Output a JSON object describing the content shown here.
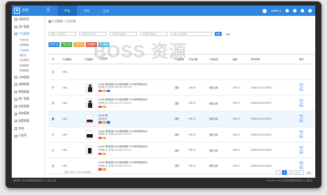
{
  "app": {
    "logo_text": "东莞",
    "menu_glyph": "☰"
  },
  "topnav": [
    {
      "label": "平台",
      "active": true
    },
    {
      "label": "手机",
      "active": false
    },
    {
      "label": "日志",
      "active": false
    }
  ],
  "user": {
    "name": "Admin ▾"
  },
  "sidebar": {
    "items": [
      {
        "label": "系统首页",
        "open": false
      },
      {
        "label": "用户管理",
        "open": false
      },
      {
        "label": "产品管理",
        "open": true
      },
      {
        "label": "订单管理",
        "open": false
      },
      {
        "label": "商铺管理",
        "open": false
      },
      {
        "label": "数据管理",
        "open": false
      },
      {
        "label": "推广管理",
        "open": false
      },
      {
        "label": "信息管理",
        "open": false
      },
      {
        "label": "系统管理",
        "open": false
      },
      {
        "label": "配置管理",
        "open": false
      },
      {
        "label": "其他",
        "open": false
      },
      {
        "label": "小程序",
        "open": false
      }
    ],
    "subitems": [
      {
        "label": "产品分类",
        "active": false
      },
      {
        "label": "品牌管理",
        "active": false
      },
      {
        "label": "产品列表",
        "active": true
      },
      {
        "label": "回收站",
        "active": false
      },
      {
        "label": "评论管理",
        "active": false
      },
      {
        "label": "咨询管理",
        "active": false
      },
      {
        "label": "规格管理",
        "active": false
      }
    ]
  },
  "breadcrumb": "产品管理 > 产品列表",
  "filters": {
    "placeholders": [
      "请输入产品名称",
      "请选择产品分类",
      "请选择产品品牌",
      "请选择产品状态"
    ],
    "wide_placeholder": "请输入产品编号",
    "search_label": "搜索",
    "reset_label": "重置"
  },
  "actions": [
    {
      "label": "添加产品",
      "color": "#2f85e0"
    },
    {
      "label": "产品上架",
      "color": "#44b549"
    },
    {
      "label": "产品下架",
      "color": "#f0ad4e"
    },
    {
      "label": "批量删除",
      "color": "#e85a4f"
    },
    {
      "label": "导出数据",
      "color": "#5bc0de"
    }
  ],
  "table": {
    "headers": [
      "产品编号",
      "产品图片",
      "产品名称",
      "产品品牌",
      "产品价格",
      "产品状态",
      "销量",
      "发布时间",
      "操作"
    ],
    "rows": [
      {
        "no": "1481",
        "name": "",
        "name2": "",
        "brand": "",
        "price": "",
        "status": "",
        "sale": "",
        "date": "",
        "tags": [],
        "selected": false,
        "image": "none"
      },
      {
        "no": "1481",
        "name": "schbie 萌妹款风 Shiel原装春季 2019秋季新款运动",
        "name2": "休闲鞋 女 男 鞋 OAR180 CM4746",
        "brand": "顶峰",
        "price": "199.00",
        "status": "销售出库",
        "sale": "199.00",
        "date": "2018/1/1/18 14:59:47",
        "tags": [
          "#e85a4f",
          "#f0ad4e",
          "#2f85e0"
        ],
        "selected": false,
        "image": "figure"
      },
      {
        "no": "1481",
        "name": "schbie 萌妹款风 Shiel原装春季 2019秋季新款运动",
        "name2": "休闲鞋 女 男 鞋 OAR180 CM4746",
        "brand": "顶峰",
        "price": "199.00",
        "status": "销售出库",
        "sale": "199.00",
        "date": "2018/1/1/18 14:59:47",
        "tags": [
          "#e85a4f",
          "#f0ad4e"
        ],
        "selected": false,
        "image": "figure"
      },
      {
        "no": "1481",
        "name": "schbie 萌",
        "name2": "萌妹款风",
        "brand": "顶峰",
        "price": "199.00",
        "status": "销售出库",
        "sale": "199.00",
        "date": "2018/1/1/18 14:59:47",
        "tags": [
          "#e85a4f",
          "#f0ad4e",
          "#2f85e0"
        ],
        "selected": true,
        "image": "shoe"
      },
      {
        "no": "1481",
        "name": "schbie 萌妹款风 Shiel原装春季 2019秋季新款运动",
        "name2": "休闲鞋 女 男 鞋 OAR180 CM4746",
        "brand": "顶峰",
        "price": "199.00",
        "status": "销售出库",
        "sale": "199.00",
        "date": "2018/1/1/18 14:59:47",
        "tags": [
          "#e85a4f",
          "#f0ad4e"
        ],
        "selected": false,
        "image": "box"
      },
      {
        "no": "1481",
        "name": "schbie 萌妹款风 Shiel原装春季 2019秋季新款运动",
        "name2": "休闲鞋 女 男 鞋 OAR180 CM4746",
        "brand": "顶峰",
        "price": "199.00",
        "status": "销售出库",
        "sale": "199.00",
        "date": "2018/1/1/18 14:59:47",
        "tags": [
          "#e85a4f",
          "#f0ad4e"
        ],
        "selected": false,
        "image": "device"
      },
      {
        "no": "1481",
        "name": "schbie 萌妹款风 Shiel原装春季 2019秋季新款运动",
        "name2": "休闲鞋 女 男 鞋 OAR180 CM4746",
        "brand": "顶峰",
        "price": "199.00",
        "status": "销售出库",
        "sale": "199.00",
        "date": "2018/1/1/18 14:59:47",
        "tags": [
          "#e85a4f",
          "#f0ad4e"
        ],
        "selected": false,
        "image": "none"
      }
    ],
    "ops": [
      "编辑",
      "上架",
      "删除"
    ]
  },
  "pagination": {
    "summary": "显示 1 到 10，共 100 条记录",
    "pages": [
      "‹",
      "1",
      "2",
      "3",
      "›"
    ],
    "active": "1",
    "jump_label": "跳至"
  },
  "footer": {
    "left": "版权所有 | 东莞创新网络科技有限公司 | 地址: 东莞",
    "right": "Copyright © 2018 东莞创新网络科技有限公司 | 备案号"
  },
  "watermark": "BOSS 资源"
}
